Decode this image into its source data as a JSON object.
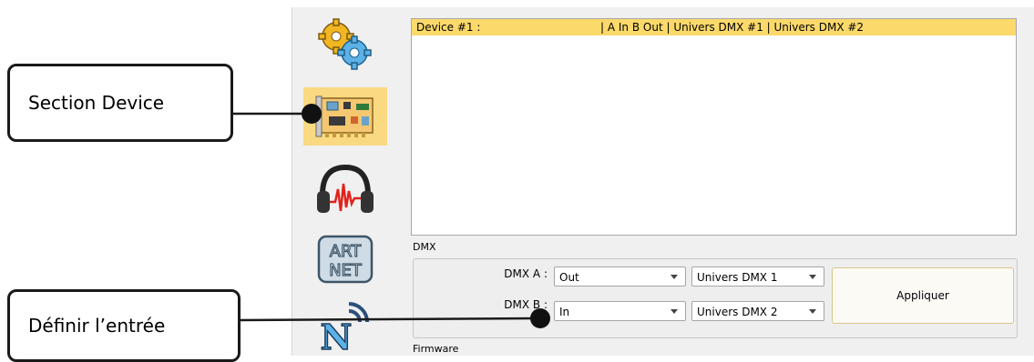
{
  "sidebar": {
    "items": [
      {
        "name": "settings",
        "icon": "gears-icon"
      },
      {
        "name": "device",
        "icon": "circuit-board-icon",
        "active": true
      },
      {
        "name": "audio",
        "icon": "headphones-waveform-icon"
      },
      {
        "name": "artnet",
        "icon": "artnet-logo-icon",
        "text_lines": [
          "ART",
          "NET"
        ]
      },
      {
        "name": "network",
        "icon": "network-signal-icon"
      }
    ]
  },
  "device_list": {
    "rows": [
      {
        "name": "Device #1 :",
        "config": "| A In B Out | Univers DMX #1 | Univers DMX #2",
        "selected": true
      }
    ],
    "selected_color": "#fbd96a"
  },
  "dmx": {
    "group_label": "DMX",
    "rows": [
      {
        "label": "DMX A :",
        "mode": "Out",
        "universe": "Univers DMX 1"
      },
      {
        "label": "DMX B :",
        "mode": "In",
        "universe": "Univers DMX 2"
      }
    ],
    "apply_label": "Appliquer"
  },
  "firmware": {
    "group_label": "Firmware"
  },
  "callouts": [
    {
      "text": "Section Device"
    },
    {
      "text": "Définir l’entrée"
    }
  ],
  "colors": {
    "accent": "#f9d981",
    "highlight": "#fbd96a",
    "button_border": "#d9c58a"
  }
}
